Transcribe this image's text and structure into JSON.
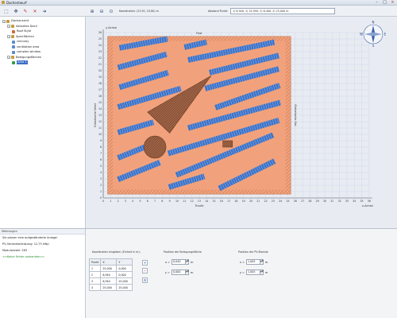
{
  "window": {
    "title": "Dachentwurf"
  },
  "toolbar": {
    "coord_label": "Koordinaten: (23,91; 25,80) m",
    "distance_label": "Abstand Punkt:",
    "distance_value": "1) 6,940; 1) 24,950; 2) 6,400; 2) 25,000 m"
  },
  "tree": {
    "items": [
      {
        "label": "Dachansicht",
        "level": 0,
        "expander": "−",
        "color": "#c79a3c"
      },
      {
        "label": "Aktuelles Dach",
        "level": 1,
        "expander": "−",
        "color": "#c79a3c"
      },
      {
        "label": "Roof Style",
        "level": 2,
        "expander": "",
        "color": "#d4693b"
      },
      {
        "label": "Sperrflächen",
        "level": 1,
        "expander": "−",
        "color": "#c79a3c"
      },
      {
        "label": "chimney",
        "level": 2,
        "expander": "",
        "color": "#5c8ad1"
      },
      {
        "label": "ventilation area",
        "level": 2,
        "expander": "",
        "color": "#5c8ad1"
      },
      {
        "label": "complex window",
        "level": 2,
        "expander": "",
        "color": "#5c8ad1"
      },
      {
        "label": "Belegungsflächen",
        "level": 1,
        "expander": "−",
        "color": "#c79a3c"
      },
      {
        "label": "Area 1",
        "level": 2,
        "expander": "",
        "color": "#3a9c46",
        "selected": true
      }
    ]
  },
  "chart_data": {
    "type": "roof-layout",
    "top_label": "First",
    "bottom_label": "Traufe",
    "left_label": "Giebelseite West",
    "right_label": "Giebelseite Ost",
    "xlabel": "x-Achse",
    "ylabel": "y-Achse",
    "xlim": [
      0,
      36
    ],
    "ylim": [
      0,
      26
    ],
    "xticks": [
      0,
      1,
      2,
      3,
      4,
      5,
      6,
      7,
      8,
      9,
      10,
      11,
      12,
      13,
      14,
      15,
      16,
      17,
      18,
      19,
      20,
      21,
      22,
      23,
      24,
      25,
      26,
      27,
      28,
      29,
      30,
      31,
      32,
      33,
      34,
      35,
      36
    ],
    "yticks": [
      0,
      1,
      2,
      3,
      4,
      5,
      6,
      7,
      8,
      9,
      10,
      11,
      12,
      13,
      14,
      15,
      16,
      17,
      18,
      19,
      20,
      21,
      22,
      23,
      24,
      25,
      26
    ],
    "roof_outer": [
      0.6,
      0.6,
      25.4,
      25.4
    ],
    "roof_inner": [
      1.3,
      1.3,
      24.7,
      24.7
    ],
    "colors": {
      "roof": "#f1a27c",
      "border": "#c87a55",
      "module": "#3e73c8",
      "obstacle": "#6b3b1e",
      "grid": "#c9d3e6"
    },
    "module_rows": [
      {
        "x1": 2.2,
        "y1": 23.6,
        "x2": 8.7,
        "y2": 25.0
      },
      {
        "x1": 11.0,
        "y1": 23.7,
        "x2": 14.0,
        "y2": 24.5
      },
      {
        "x1": 2.0,
        "y1": 20.5,
        "x2": 8.6,
        "y2": 22.6
      },
      {
        "x1": 11.5,
        "y1": 21.7,
        "x2": 23.2,
        "y2": 24.5
      },
      {
        "x1": 2.2,
        "y1": 17.4,
        "x2": 8.8,
        "y2": 19.7
      },
      {
        "x1": 14.4,
        "y1": 19.7,
        "x2": 23.8,
        "y2": 22.4
      },
      {
        "x1": 2.0,
        "y1": 14.3,
        "x2": 10.5,
        "y2": 17.2
      },
      {
        "x1": 13.8,
        "y1": 17.2,
        "x2": 23.8,
        "y2": 20.3
      },
      {
        "x1": 15.2,
        "y1": 14.2,
        "x2": 23.9,
        "y2": 17.7
      },
      {
        "x1": 11.5,
        "y1": 11.0,
        "x2": 24.0,
        "y2": 15.0
      },
      {
        "x1": 2.0,
        "y1": 10.3,
        "x2": 6.8,
        "y2": 11.9
      },
      {
        "x1": 8.8,
        "y1": 7.0,
        "x2": 23.8,
        "y2": 12.2
      },
      {
        "x1": 2.0,
        "y1": 6.3,
        "x2": 6.7,
        "y2": 8.5
      },
      {
        "x1": 9.9,
        "y1": 3.6,
        "x2": 23.0,
        "y2": 9.9
      },
      {
        "x1": 2.0,
        "y1": 2.9,
        "x2": 7.7,
        "y2": 5.6
      },
      {
        "x1": 8.9,
        "y1": 1.7,
        "x2": 13.7,
        "y2": 3.4
      },
      {
        "x1": 15.7,
        "y1": 1.5,
        "x2": 23.2,
        "y2": 5.8
      }
    ],
    "triangle": [
      [
        6.0,
        13.5
      ],
      [
        14.6,
        19.2
      ],
      [
        9.0,
        10.2
      ]
    ],
    "circle": {
      "cx": 7.0,
      "cy": 8.0,
      "r": 1.5
    },
    "rect": {
      "x": 16.2,
      "y": 8.0,
      "w": 1.3,
      "h": 1.0
    }
  },
  "compass": {
    "n": "N",
    "e": "E",
    "s": "S",
    "w": "W"
  },
  "messages": {
    "header": "Meldungen",
    "lines": [
      {
        "text": "Sie planen eine aufgeständerte Anlage!",
        "green": false
      },
      {
        "text": "PV-Generatorleistung: 12,75 kWp",
        "green": false
      },
      {
        "text": "Modulanzahl: 263",
        "green": false
      },
      {
        "text": "<<Keine Fehler vorhanden>>",
        "green": true
      }
    ]
  },
  "coords": {
    "header": "Koordinaten eingeben (Einheit in m):",
    "columns": [
      "Punkt",
      "X",
      "Y"
    ],
    "rows": [
      [
        "1",
        "25,000",
        "0,000"
      ],
      [
        "2",
        "6,940",
        "0,000"
      ],
      [
        "3",
        "6,940",
        "25,000"
      ],
      [
        "4",
        "25,000",
        "25,000"
      ]
    ]
  },
  "area_position": {
    "header": "Position der Belegungsfläche",
    "x_label": "x =",
    "x_value": "0,040",
    "x_unit": "m",
    "y_label": "y =",
    "y_value": "0,000",
    "y_unit": "m"
  },
  "module_position": {
    "header": "Position der PV-Module",
    "x_label": "x =",
    "x_value": "1,005",
    "x_unit": "m",
    "y_label": "y =",
    "y_value": "1,005",
    "y_unit": "m"
  }
}
